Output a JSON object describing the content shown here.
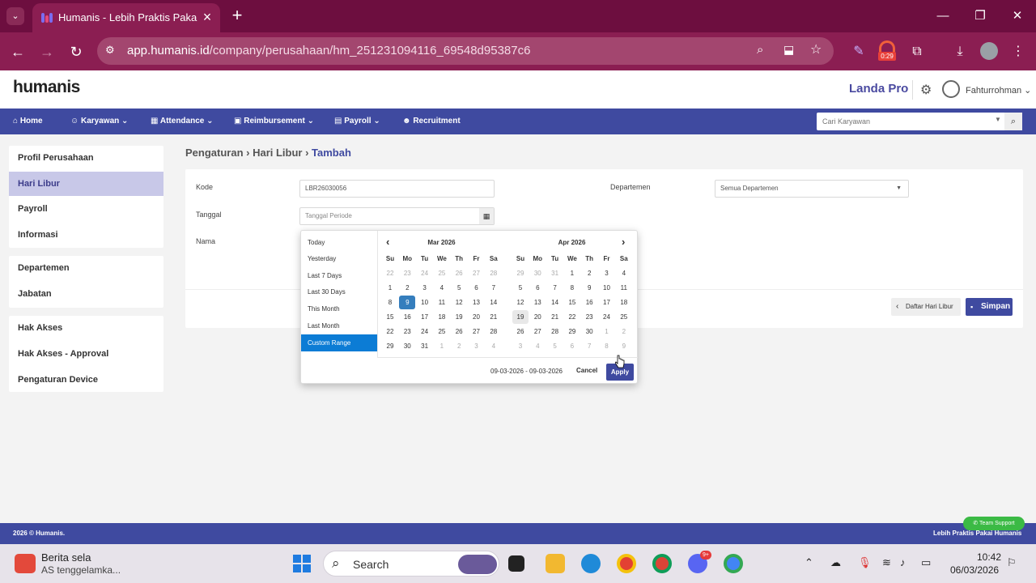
{
  "browser": {
    "tab_title": "Humanis - Lebih Praktis Pakai H",
    "url_host": "app.humanis.id",
    "url_path": "/company/perusahaan/hm_251231094116_69548d95387c6",
    "timer_badge": "0:29"
  },
  "header": {
    "logo": "humanis",
    "brand": "Landa Pro",
    "username": "Fahturrohman"
  },
  "nav": {
    "items": [
      "Home",
      "Karyawan",
      "Attendance",
      "Reimbursement",
      "Payroll",
      "Recruitment"
    ],
    "search_placeholder": "Cari Karyawan"
  },
  "sidebar": {
    "group1": [
      "Profil Perusahaan",
      "Hari Libur",
      "Payroll",
      "Informasi"
    ],
    "group2": [
      "Departemen",
      "Jabatan"
    ],
    "group3": [
      "Hak Akses",
      "Hak Akses - Approval",
      "Pengaturan Device"
    ],
    "active": "Hari Libur"
  },
  "breadcrumb": {
    "root": "Pengaturan",
    "section": "Hari Libur",
    "current": "Tambah"
  },
  "form": {
    "kode_label": "Kode",
    "kode_value": "LBR26030056",
    "tanggal_label": "Tanggal",
    "tanggal_placeholder": "Tanggal Periode",
    "nama_label": "Nama",
    "departemen_label": "Departemen",
    "departemen_value": "Semua Departemen",
    "list_button": "Daftar Hari Libur",
    "save_button": "Simpan"
  },
  "datepicker": {
    "ranges": [
      "Today",
      "Yesterday",
      "Last 7 Days",
      "Last 30 Days",
      "This Month",
      "Last Month",
      "Custom Range"
    ],
    "active_range": "Custom Range",
    "weekdays": [
      "Su",
      "Mo",
      "Tu",
      "We",
      "Th",
      "Fr",
      "Sa"
    ],
    "left_month": {
      "title": "Mar 2026",
      "days": [
        [
          22,
          23,
          24,
          25,
          26,
          27,
          28
        ],
        [
          1,
          2,
          3,
          4,
          5,
          6,
          7
        ],
        [
          8,
          9,
          10,
          11,
          12,
          13,
          14
        ],
        [
          15,
          16,
          17,
          18,
          19,
          20,
          21
        ],
        [
          22,
          23,
          24,
          25,
          26,
          27,
          28
        ],
        [
          29,
          30,
          31,
          1,
          2,
          3,
          4
        ]
      ],
      "selected": 9
    },
    "right_month": {
      "title": "Apr 2026",
      "days": [
        [
          29,
          30,
          31,
          1,
          2,
          3,
          4
        ],
        [
          5,
          6,
          7,
          8,
          9,
          10,
          11
        ],
        [
          12,
          13,
          14,
          15,
          16,
          17,
          18
        ],
        [
          19,
          20,
          21,
          22,
          23,
          24,
          25
        ],
        [
          26,
          27,
          28,
          29,
          30,
          1,
          2
        ],
        [
          3,
          4,
          5,
          6,
          7,
          8,
          9
        ]
      ]
    },
    "range_text": "09-03-2026 - 09-03-2026",
    "cancel": "Cancel",
    "apply": "Apply"
  },
  "footer": {
    "copyright": "2026 © Humanis.",
    "tagline": "Lebih Praktis Pakai Humanis",
    "support": "Team Support"
  },
  "taskbar": {
    "news_title": "Berita sela",
    "news_sub": "AS tenggelamka...",
    "search": "Search",
    "discord_badge": "9+",
    "time": "10:42",
    "date": "06/03/2026"
  },
  "colors": {
    "chrome": "#8b1e52",
    "primary": "#3f4aa0",
    "selected_day": "#357ebd",
    "active_range": "#0c7cd5"
  }
}
